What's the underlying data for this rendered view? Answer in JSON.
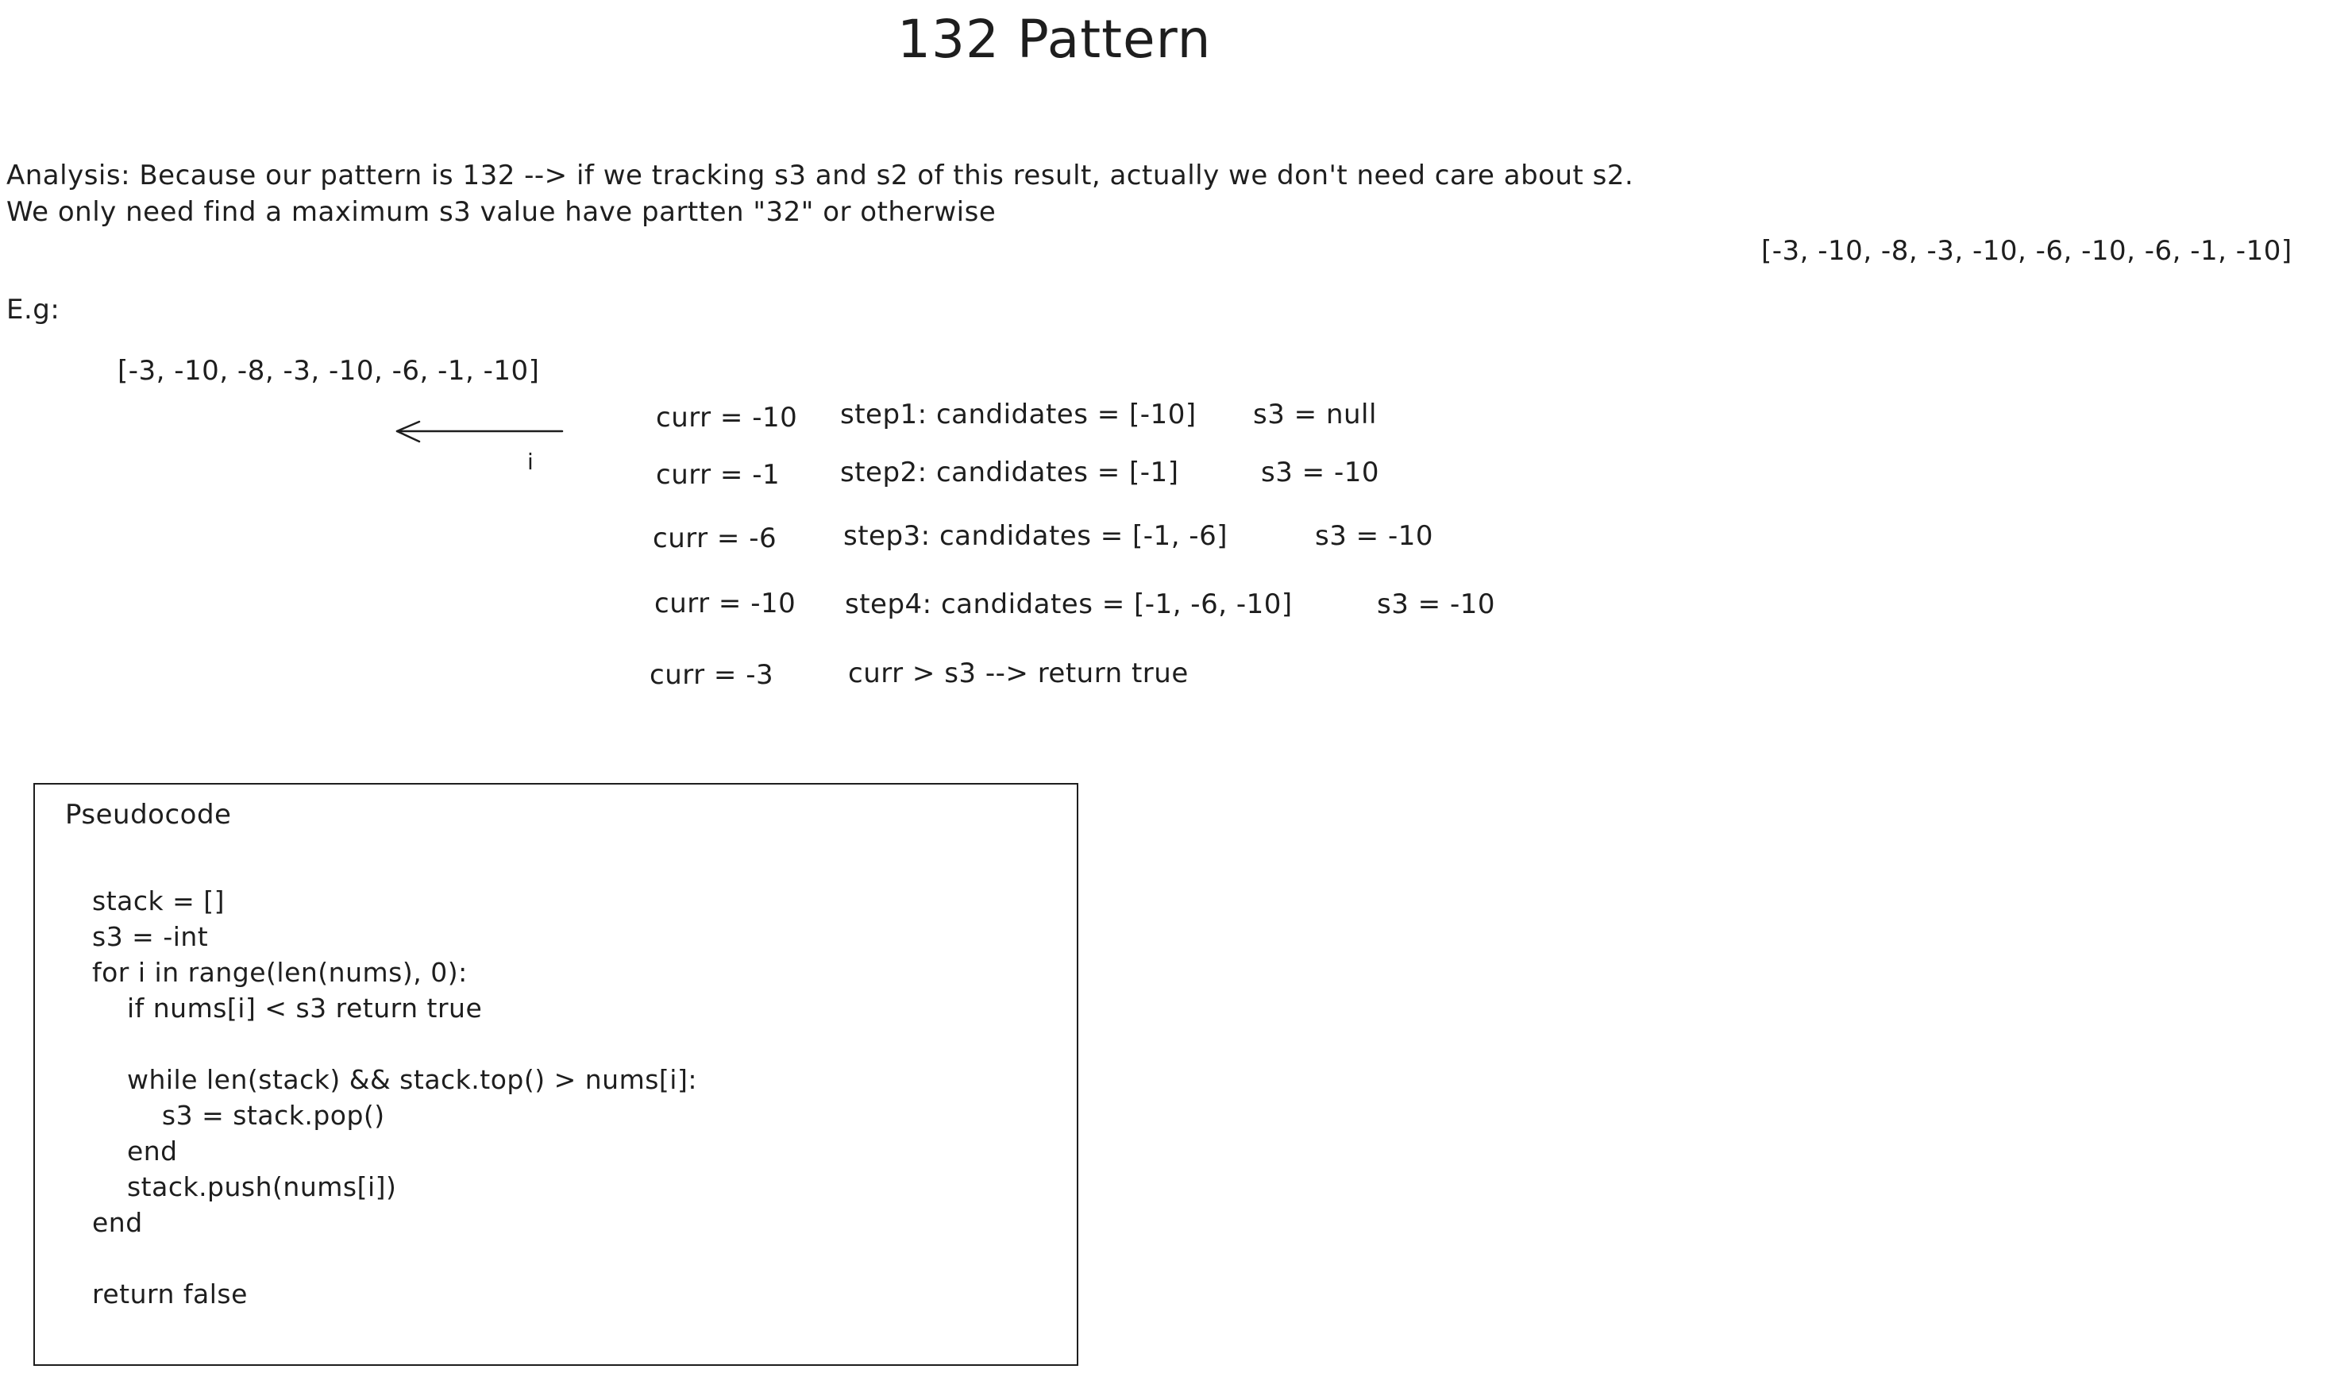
{
  "title": "132 Pattern",
  "analysis": {
    "line1": "Analysis: Because our pattern is 132 --> if we tracking s3 and s2 of this result, actually we don't need care about s2.",
    "line2": "We only need find a maximum s3 value have partten \"32\" or otherwise"
  },
  "right_array": "[-3, -10, -8, -3, -10, -6, -10, -6, -1, -10]",
  "example": {
    "label": "E.g:",
    "array": "[-3, -10, -8, -3, -10, -6, -1, -10]",
    "index_label": "i"
  },
  "steps": [
    {
      "curr": "curr = -10",
      "desc": "step1: candidates = [-10]",
      "s3": "s3 = null"
    },
    {
      "curr": "curr = -1",
      "desc": "step2: candidates = [-1]",
      "s3": "s3 = -10"
    },
    {
      "curr": "curr = -6",
      "desc": "step3: candidates = [-1, -6]",
      "s3": "s3 = -10"
    },
    {
      "curr": "curr = -10",
      "desc": "step4: candidates = [-1, -6, -10]",
      "s3": "s3 = -10"
    },
    {
      "curr": "curr = -3",
      "desc": "curr > s3 --> return true",
      "s3": ""
    }
  ],
  "pseudocode": {
    "title": "Pseudocode",
    "lines": [
      "stack = []",
      "s3 = -int",
      "for i in range(len(nums), 0):",
      "    if nums[i] < s3 return true",
      "",
      "    while len(stack) && stack.top() > nums[i]:",
      "        s3 = stack.pop()",
      "    end",
      "    stack.push(nums[i])",
      "end",
      "",
      "return false"
    ]
  }
}
